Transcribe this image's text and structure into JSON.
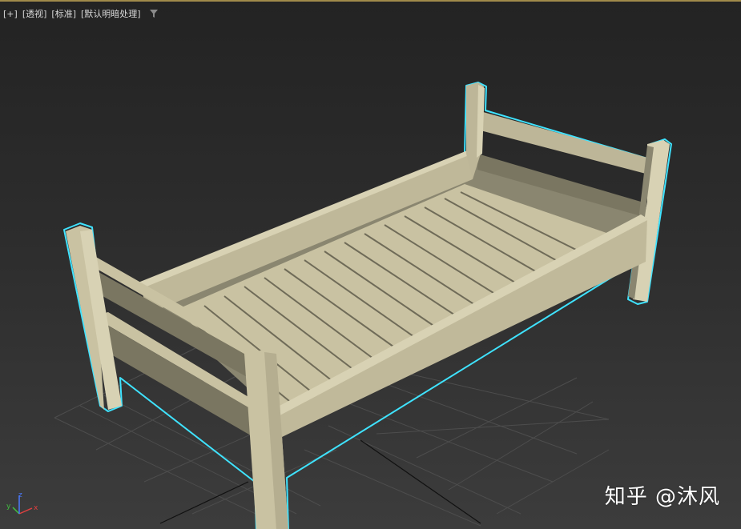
{
  "viewport": {
    "labels": [
      "[+]",
      "[透视]",
      "[标准]",
      "[默认明暗处理]"
    ],
    "filter_icon": "filter-funnel-icon"
  },
  "gizmo": {
    "x_label": "x",
    "y_label": "y",
    "z_label": "z"
  },
  "watermark": "知乎 @沐风",
  "colors": {
    "wood_light": "#d3cdae",
    "wood_mid": "#bdb698",
    "wood_dark": "#7a7661",
    "selection_outline": "#3fe3ff",
    "grid_line": "#555555",
    "border_accent": "#a08a4a"
  }
}
